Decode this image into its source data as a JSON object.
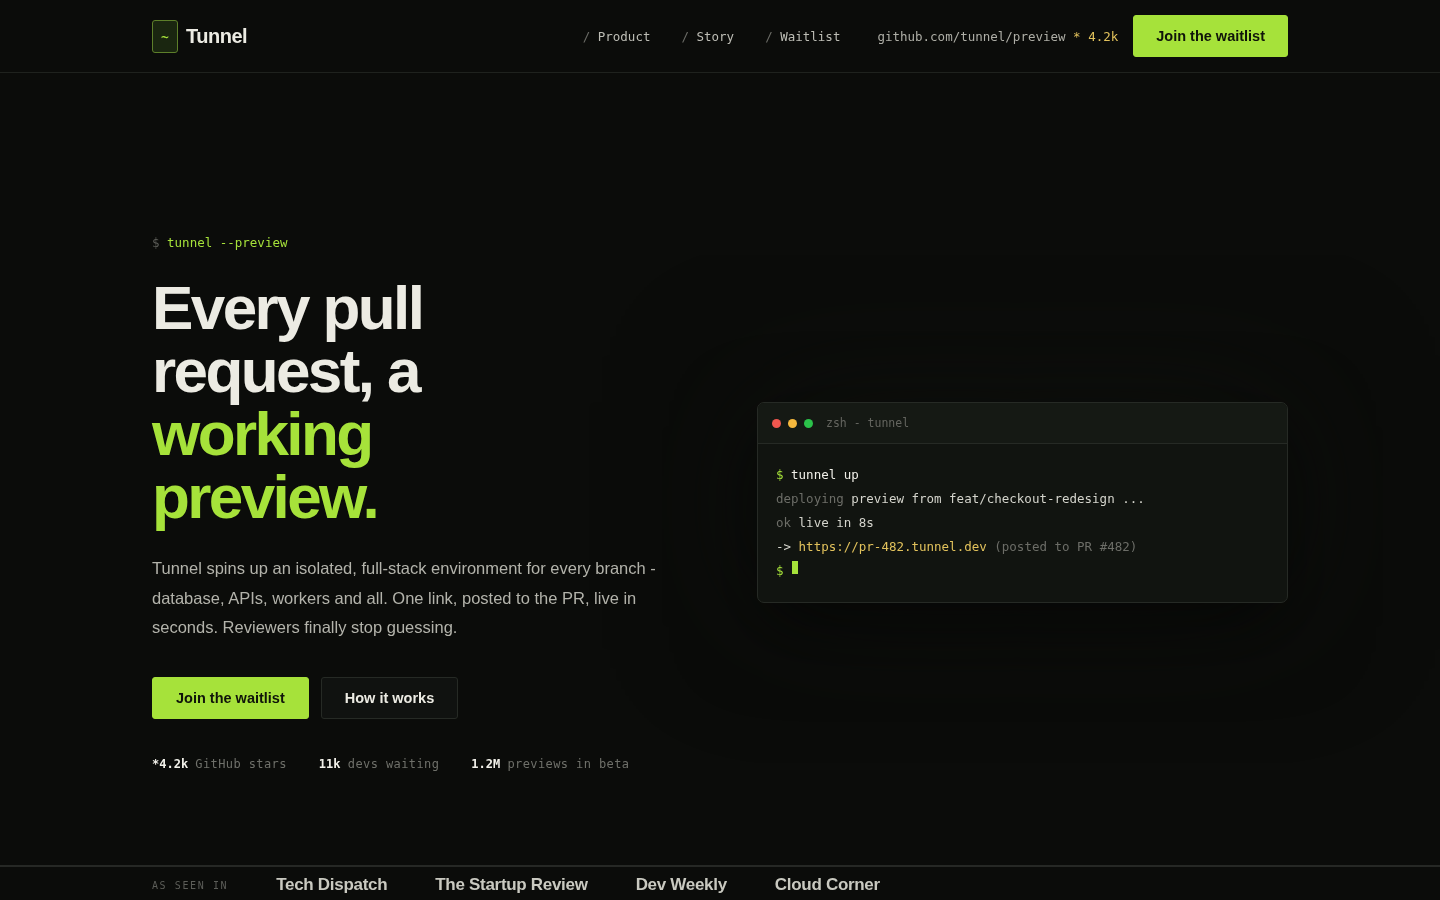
{
  "header": {
    "logo_mark": "~",
    "brand": "Tunnel",
    "nav": [
      {
        "prefix": "/",
        "label": "Product"
      },
      {
        "prefix": "/",
        "label": "Story"
      },
      {
        "prefix": "/",
        "label": "Waitlist"
      }
    ],
    "repo": {
      "path": "github.com/tunnel/preview",
      "stars": "* 4.2k"
    },
    "cta": "Join the waitlist"
  },
  "hero": {
    "command": {
      "prompt": "$",
      "text": "tunnel --preview"
    },
    "heading": {
      "lead": "Every pull request, a",
      "accent": "working preview."
    },
    "description": "Tunnel spins up an isolated, full-stack environment for every branch - database, APIs, workers and all. One link, posted to the PR, live in seconds. Reviewers finally stop guessing.",
    "buttons": [
      {
        "label": "Join the waitlist",
        "kind": "primary"
      },
      {
        "label": "How it works",
        "kind": "secondary"
      }
    ],
    "stats": [
      {
        "value": "*4.2k",
        "label": "GitHub stars"
      },
      {
        "value": "11k",
        "label": "devs waiting"
      },
      {
        "value": "1.2M",
        "label": "previews in beta"
      }
    ]
  },
  "terminal": {
    "title": "zsh - tunnel",
    "lines": [
      {
        "segments": [
          {
            "text": "$",
            "kind": "prompt"
          },
          {
            "text": "tunnel up",
            "kind": "command"
          }
        ],
        "cursor": false
      },
      {
        "segments": [
          {
            "text": "deploying",
            "kind": "muted"
          },
          {
            "text": "preview from feat/checkout-redesign ...",
            "kind": "output"
          }
        ],
        "cursor": false
      },
      {
        "segments": [
          {
            "text": "ok",
            "kind": "muted"
          },
          {
            "text": "live in 8s",
            "kind": "output"
          }
        ],
        "cursor": false
      },
      {
        "segments": [
          {
            "text": "->",
            "kind": "output"
          },
          {
            "text": "https://pr-482.tunnel.dev",
            "kind": "link"
          },
          {
            "text": "(posted to PR #482)",
            "kind": "muted"
          }
        ],
        "cursor": false
      },
      {
        "segments": [
          {
            "text": "$",
            "kind": "prompt"
          }
        ],
        "cursor": true
      }
    ]
  },
  "press": {
    "label": "AS SEEN IN",
    "outlets": [
      "Tech Dispatch",
      "The Startup Review",
      "Dev Weekly",
      "Cloud Corner"
    ]
  }
}
